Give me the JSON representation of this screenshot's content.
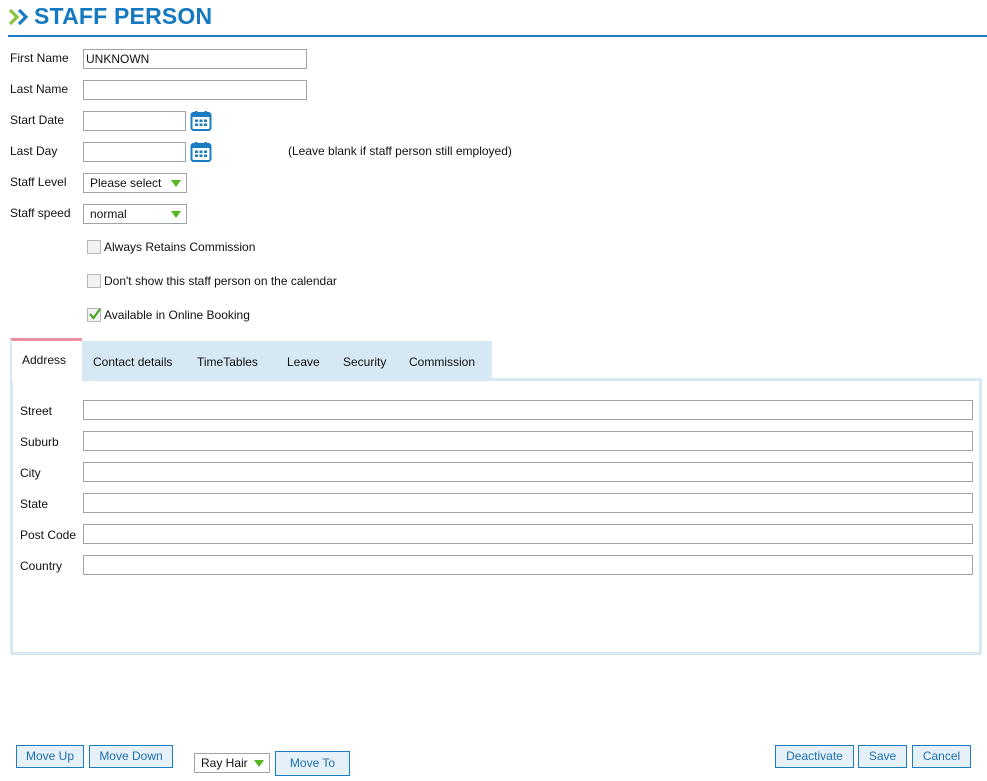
{
  "header": {
    "title": "STAFF PERSON",
    "icon": "double-chevron-icon"
  },
  "form": {
    "first_name": {
      "label": "First Name",
      "value": "UNKNOWN"
    },
    "last_name": {
      "label": "Last Name",
      "value": ""
    },
    "start_date": {
      "label": "Start Date",
      "value": "",
      "icon": "calendar-icon"
    },
    "last_day": {
      "label": "Last Day",
      "value": "",
      "icon": "calendar-icon",
      "note": "(Leave blank if staff person still employed)"
    },
    "staff_level": {
      "label": "Staff Level",
      "selected": "Please select"
    },
    "staff_speed": {
      "label": "Staff speed",
      "selected": "normal"
    },
    "checkboxes": [
      {
        "label": "Always Retains Commission",
        "checked": false
      },
      {
        "label": "Don't show this staff person on the calendar",
        "checked": false
      },
      {
        "label": "Available in Online Booking",
        "checked": true
      }
    ]
  },
  "tabs": [
    "Address",
    "Contact details",
    "TimeTables",
    "Leave",
    "Security",
    "Commission"
  ],
  "active_tab": "Address",
  "address": {
    "street": {
      "label": "Street",
      "value": ""
    },
    "suburb": {
      "label": "Suburb",
      "value": ""
    },
    "city": {
      "label": "City",
      "value": ""
    },
    "state": {
      "label": "State",
      "value": ""
    },
    "post_code": {
      "label": "Post Code",
      "value": ""
    },
    "country": {
      "label": "Country",
      "value": ""
    }
  },
  "footer": {
    "move_up": "Move Up",
    "move_down": "Move Down",
    "location_selected": "Ray Hair",
    "move_to": "Move To",
    "deactivate": "Deactivate",
    "save": "Save",
    "cancel": "Cancel"
  },
  "colors": {
    "accent_blue": "#1479c0",
    "tab_bg": "#d6e8f4",
    "active_tab_border": "#ee8ea0",
    "caret_green": "#55b522"
  }
}
